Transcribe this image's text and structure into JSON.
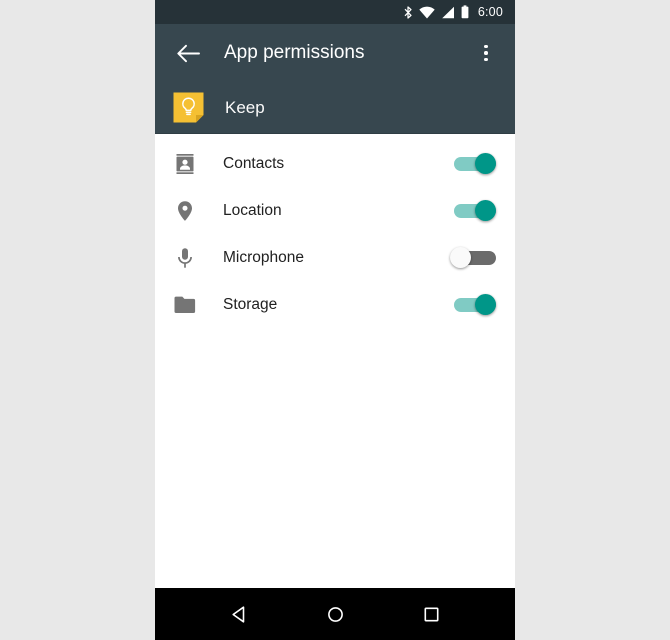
{
  "status_bar": {
    "time": "6:00",
    "icons": [
      "bluetooth-icon",
      "wifi-icon",
      "cellular-signal-icon",
      "battery-icon"
    ]
  },
  "app_bar": {
    "title": "App permissions",
    "back_icon": "back-arrow-icon",
    "overflow_icon": "overflow-menu-icon"
  },
  "app_header": {
    "name": "Keep",
    "icon": "keep-app-icon",
    "icon_color": "#f5c033"
  },
  "permissions": [
    {
      "label": "Contacts",
      "icon": "contacts-icon",
      "enabled": true
    },
    {
      "label": "Location",
      "icon": "location-pin-icon",
      "enabled": true
    },
    {
      "label": "Microphone",
      "icon": "microphone-icon",
      "enabled": false
    },
    {
      "label": "Storage",
      "icon": "folder-icon",
      "enabled": true
    }
  ],
  "nav_bar": {
    "back": "nav-back-icon",
    "home": "nav-home-icon",
    "recents": "nav-recents-icon"
  },
  "colors": {
    "app_bar": "#37474f",
    "status_bar": "#263238",
    "switch_on_thumb": "#009688",
    "switch_on_track": "#80cbc4",
    "switch_off_track": "#6b6b6b",
    "page_background": "#e8e8e8"
  }
}
